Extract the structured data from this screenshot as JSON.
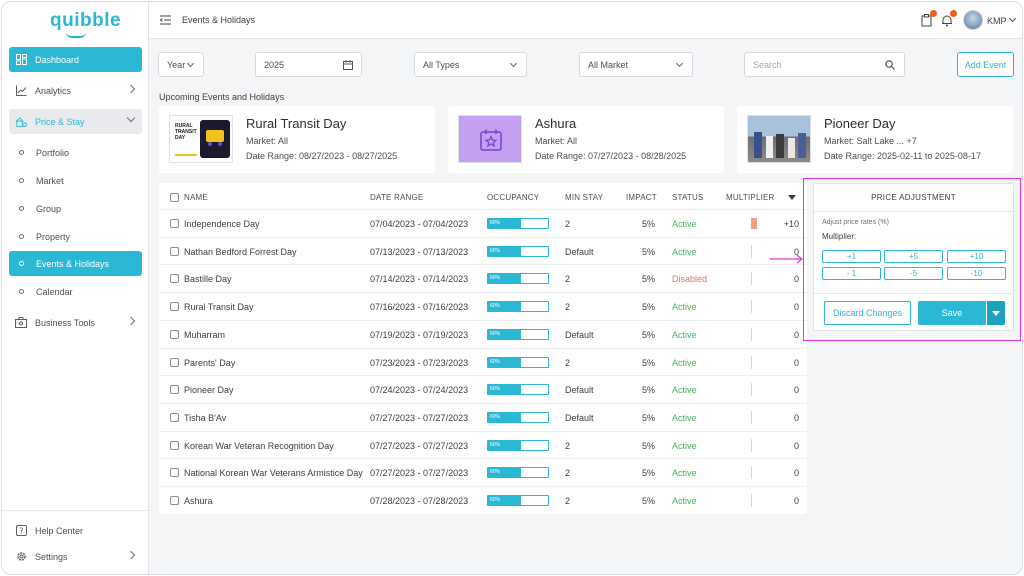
{
  "app": {
    "logo": "quibble"
  },
  "sidebar": {
    "dashboard": "Dashboard",
    "analytics": "Analytics",
    "price_stay": "Price & Stay",
    "sub": [
      "Portfolio",
      "Market",
      "Group",
      "Property",
      "Events & Holidays",
      "Calendar"
    ],
    "business_tools": "Business Tools",
    "help": "Help Center",
    "settings": "Settings"
  },
  "topbar": {
    "title": "Events & Holidays",
    "user": "KMP",
    "accent": "#2bb8d4",
    "badge_color": "#f05a28"
  },
  "filters": {
    "period": "Year",
    "year": "2025",
    "type": "All Types",
    "market": "All Market",
    "search_placeholder": "Search",
    "add_event": "Add Event"
  },
  "upcoming": {
    "title": "Upcoming Events and Holidays",
    "cards": [
      {
        "name": "Rural Transit Day",
        "market": "Market:  All",
        "range": "Date Range: 08/27/2023 - 08/27/2025",
        "thumb_text": "RURAL TRANSIT DAY"
      },
      {
        "name": "Ashura",
        "market": "Market:  All",
        "range": "Date Range: 07/27/2023 - 08/28/2025"
      },
      {
        "name": "Pioneer Day",
        "market": "Market: Salt Lake ... +7",
        "range": "Date Range: 2025-02-11 to 2025-08-17"
      }
    ]
  },
  "table": {
    "headers": {
      "name": "NAME",
      "date": "DATE RANGE",
      "occupancy": "OCCUPANCY",
      "minstay": "MIN STAY",
      "impact": "IMPACT",
      "status": "STATUS",
      "multiplier": "MULTIPLIER"
    },
    "occupancy_label": "60%",
    "occupancy_fraction": 0.55,
    "rows": [
      {
        "name": "Independence Day",
        "date": "07/04/2023 - 07/04/2023",
        "minstay": "2",
        "impact": "5%",
        "status": "Active",
        "mult": "+10",
        "mult_marker": true
      },
      {
        "name": "Nathan Bedford Forrest Day",
        "date": "07/13/2023 - 07/13/2023",
        "minstay": "Default",
        "impact": "5%",
        "status": "Active",
        "mult": "0"
      },
      {
        "name": "Bastille Day",
        "date": "07/14/2023 -  07/14/2023",
        "minstay": "2",
        "impact": "5%",
        "status": "Disabled",
        "mult": "0"
      },
      {
        "name": "Rural Transit Day",
        "date": "07/16/2023 - 07/16/2023",
        "minstay": "2",
        "impact": "5%",
        "status": "Active",
        "mult": "0"
      },
      {
        "name": "Muharram",
        "date": "07/19/2023 - 07/19/2023",
        "minstay": "Default",
        "impact": "5%",
        "status": "Active",
        "mult": "0"
      },
      {
        "name": "Parents' Day",
        "date": "07/23/2023 - 07/23/2023",
        "minstay": "2",
        "impact": "5%",
        "status": "Active",
        "mult": "0"
      },
      {
        "name": "Pioneer Day",
        "date": "07/24/2023 - 07/24/2023",
        "minstay": "Default",
        "impact": "5%",
        "status": "Active",
        "mult": "0"
      },
      {
        "name": "Tisha B'Av",
        "date": "07/27/2023 - 07/27/2023",
        "minstay": "Default",
        "impact": "5%",
        "status": "Active",
        "mult": "0"
      },
      {
        "name": "Korean War Veteran Recognition Day",
        "date": "07/27/2023 - 07/27/2023",
        "minstay": "2",
        "impact": "5%",
        "status": "Active",
        "mult": "0"
      },
      {
        "name": "National Korean War Veterans Armistice Day",
        "date": "07/27/2023 - 07/27/2023",
        "minstay": "2",
        "impact": "5%",
        "status": "Active",
        "mult": "0"
      },
      {
        "name": "Ashura",
        "date": "07/28/2023 - 07/28/2023",
        "minstay": "2",
        "impact": "5%",
        "status": "Active",
        "mult": "0"
      }
    ]
  },
  "price_adjustment": {
    "title": "PRICE ADJUSTMENT",
    "label": "Adjust price rates (%)",
    "multiplier_label": "Multiplier:",
    "buttons": [
      "+1",
      "+5",
      "+10",
      "- 1",
      "-5",
      "-10"
    ],
    "discard": "Discard Changes",
    "save": "Save",
    "highlight_color": "#e534d9"
  }
}
